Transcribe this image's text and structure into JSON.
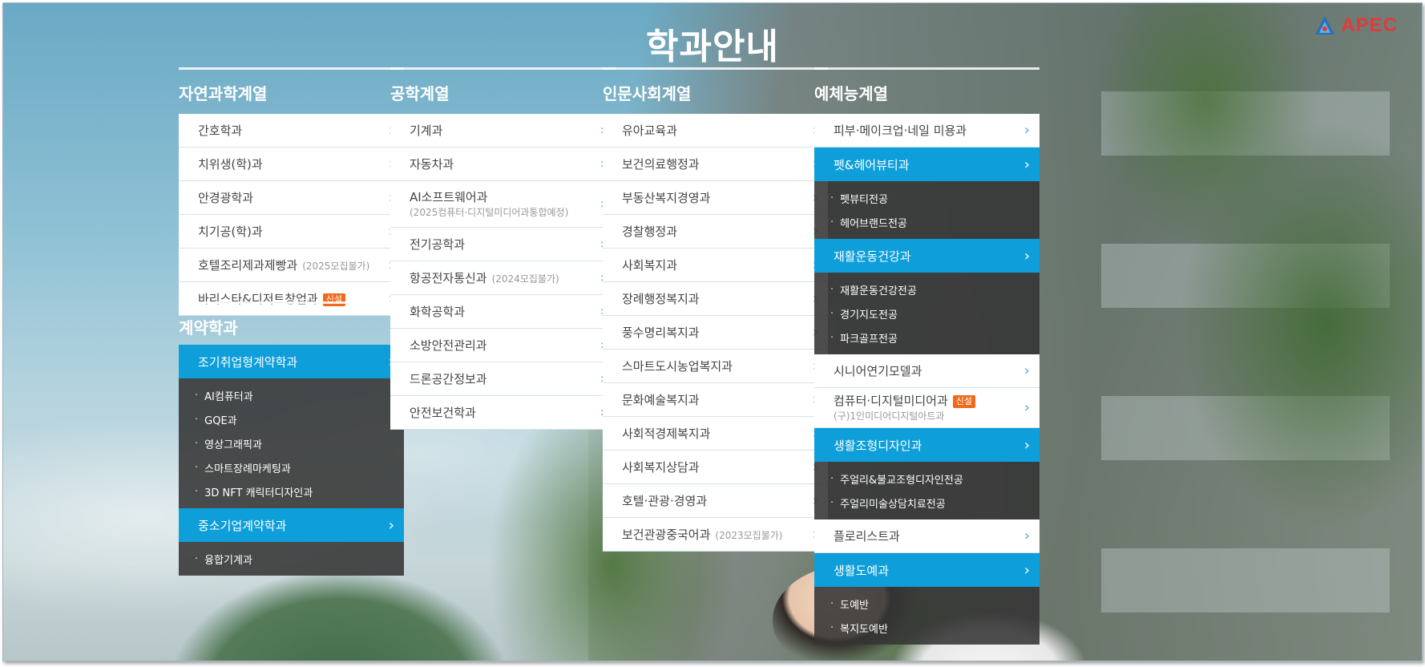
{
  "page": {
    "title": "학과안내"
  },
  "logo": {
    "text": "APEC",
    "icon": "triangle-logo-icon"
  },
  "colors": {
    "accent": "#0e9fda",
    "badge": "#ef6a1a",
    "sublist_bg": "#343434"
  },
  "columns": [
    {
      "heading": "자연과학계열",
      "items": [
        {
          "label": "간호학과"
        },
        {
          "label": "치위생(학)과"
        },
        {
          "label": "안경광학과"
        },
        {
          "label": "치기공(학)과"
        },
        {
          "label": "호텔조리제과제빵과",
          "note": "(2025모집불가)"
        },
        {
          "label": "바리스타&디저트창업과",
          "badge": "신설"
        }
      ]
    },
    {
      "heading": "공학계열",
      "items": [
        {
          "label": "기계과"
        },
        {
          "label": "자동차과"
        },
        {
          "label": "AI소프트웨어과",
          "sub_note": "(2025컴퓨터·디지털미디어과통합예정)"
        },
        {
          "label": "전기공학과"
        },
        {
          "label": "항공전자통신과",
          "note": "(2024모집불가)"
        },
        {
          "label": "화학공학과"
        },
        {
          "label": "소방안전관리과"
        },
        {
          "label": "드론공간정보과"
        },
        {
          "label": "안전보건학과"
        }
      ]
    },
    {
      "heading": "인문사회계열",
      "items": [
        {
          "label": "유아교육과"
        },
        {
          "label": "보건의료행정과"
        },
        {
          "label": "부동산복지경영과"
        },
        {
          "label": "경찰행정과"
        },
        {
          "label": "사회복지과"
        },
        {
          "label": "장례행정복지과"
        },
        {
          "label": "풍수명리복지과"
        },
        {
          "label": "스마트도시농업복지과"
        },
        {
          "label": "문화예술복지과"
        },
        {
          "label": "사회적경제복지과"
        },
        {
          "label": "사회복지상담과"
        },
        {
          "label": "호텔·관광·경영과"
        },
        {
          "label": "보건관광중국어과",
          "note": "(2023모집불가)"
        }
      ]
    },
    {
      "heading": "예체능계열",
      "items": [
        {
          "label": "피부·메이크업·네일 미용과"
        },
        {
          "label": "펫&헤어뷰티과",
          "active": true,
          "subitems": [
            "펫뷰티전공",
            "헤어브랜드전공"
          ]
        },
        {
          "label": "재활운동건강과",
          "active": true,
          "subitems": [
            "재활운동건강전공",
            "경기지도전공",
            "파크골프전공"
          ]
        },
        {
          "label": "시니어연기모델과"
        },
        {
          "label": "컴퓨터·디지털미디어과",
          "badge": "신설",
          "sub_note": "(구)1인미디어디지털아트과"
        },
        {
          "label": "생활조형디자인과",
          "active": true,
          "subitems": [
            "주얼리&불교조형디자인전공",
            "주얼리미술상담치료전공"
          ]
        },
        {
          "label": "플로리스트과"
        },
        {
          "label": "생활도예과",
          "active": true,
          "subitems": [
            "도예반",
            "복지도예반"
          ]
        }
      ]
    }
  ],
  "contract": {
    "heading": "계약학과",
    "items": [
      {
        "label": "조기취업형계약학과",
        "active": true,
        "subitems": [
          "AI컴퓨터과",
          "GQE과",
          "영상그래픽과",
          "스마트장례마케팅과",
          "3D NFT 캐릭터디자인과"
        ]
      },
      {
        "label": "중소기업계약학과",
        "active": true,
        "subitems": [
          "융합기계과"
        ]
      }
    ]
  },
  "chevron": "›"
}
